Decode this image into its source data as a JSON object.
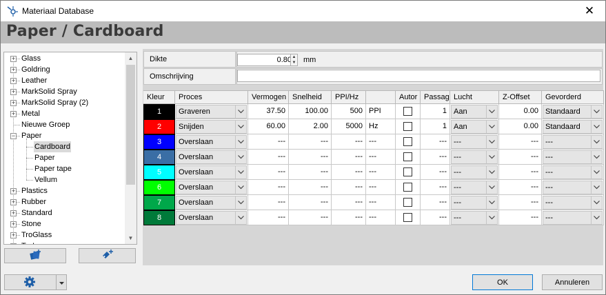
{
  "window": {
    "title": "Materiaal Database",
    "close_label": "✕"
  },
  "page_title": "Paper / Cardboard",
  "tree": {
    "items": [
      {
        "label": "Glass",
        "expander": "+",
        "level": 0
      },
      {
        "label": "Goldring",
        "expander": "+",
        "level": 0
      },
      {
        "label": "Leather",
        "expander": "+",
        "level": 0
      },
      {
        "label": "MarkSolid Spray",
        "expander": "+",
        "level": 0
      },
      {
        "label": "MarkSolid Spray (2)",
        "expander": "+",
        "level": 0
      },
      {
        "label": "Metal",
        "expander": "+",
        "level": 0
      },
      {
        "label": "Nieuwe Groep",
        "expander": "",
        "level": 0
      },
      {
        "label": "Paper",
        "expander": "−",
        "level": 0
      },
      {
        "label": "Cardboard",
        "expander": "",
        "level": 1,
        "selected": true
      },
      {
        "label": "Paper",
        "expander": "",
        "level": 1
      },
      {
        "label": "Paper tape",
        "expander": "",
        "level": 1
      },
      {
        "label": "Vellum",
        "expander": "",
        "level": 1
      },
      {
        "label": "Plastics",
        "expander": "+",
        "level": 0
      },
      {
        "label": "Rubber",
        "expander": "+",
        "level": 0
      },
      {
        "label": "Standard",
        "expander": "+",
        "level": 0
      },
      {
        "label": "Stone",
        "expander": "+",
        "level": 0
      },
      {
        "label": "TroGlass",
        "expander": "+",
        "level": 0
      },
      {
        "label": "TroLase",
        "expander": "+",
        "level": 0
      }
    ]
  },
  "properties": {
    "thickness_label": "Dikte",
    "thickness_value": "0.80",
    "thickness_unit": "mm",
    "description_label": "Omschrijving",
    "description_value": ""
  },
  "grid": {
    "headers": [
      "Kleur",
      "Proces",
      "Vermogen",
      "Snelheid",
      "PPI/Hz",
      "",
      "Autor",
      "Passage",
      "Lucht",
      "Z-Offset",
      "Gevorderd"
    ],
    "rows": [
      {
        "num": "1",
        "color": "#000000",
        "proces": "Graveren",
        "vermogen": "37.50",
        "snelheid": "100.00",
        "ppi": "500",
        "unit": "PPI",
        "passage": "1",
        "lucht": "Aan",
        "zoffset": "0.00",
        "gevorderd": "Standaard"
      },
      {
        "num": "2",
        "color": "#ff0000",
        "proces": "Snijden",
        "vermogen": "60.00",
        "snelheid": "2.00",
        "ppi": "5000",
        "unit": "Hz",
        "passage": "1",
        "lucht": "Aan",
        "zoffset": "0.00",
        "gevorderd": "Standaard"
      },
      {
        "num": "3",
        "color": "#0000ff",
        "proces": "Overslaan",
        "vermogen": "---",
        "snelheid": "---",
        "ppi": "---",
        "unit": "---",
        "passage": "---",
        "lucht": "---",
        "zoffset": "---",
        "gevorderd": "---"
      },
      {
        "num": "4",
        "color": "#3a6ea5",
        "proces": "Overslaan",
        "vermogen": "---",
        "snelheid": "---",
        "ppi": "---",
        "unit": "---",
        "passage": "---",
        "lucht": "---",
        "zoffset": "---",
        "gevorderd": "---"
      },
      {
        "num": "5",
        "color": "#00ffff",
        "proces": "Overslaan",
        "vermogen": "---",
        "snelheid": "---",
        "ppi": "---",
        "unit": "---",
        "passage": "---",
        "lucht": "---",
        "zoffset": "---",
        "gevorderd": "---"
      },
      {
        "num": "6",
        "color": "#00ff00",
        "proces": "Overslaan",
        "vermogen": "---",
        "snelheid": "---",
        "ppi": "---",
        "unit": "---",
        "passage": "---",
        "lucht": "---",
        "zoffset": "---",
        "gevorderd": "---"
      },
      {
        "num": "7",
        "color": "#00a84a",
        "proces": "Overslaan",
        "vermogen": "---",
        "snelheid": "---",
        "ppi": "---",
        "unit": "---",
        "passage": "---",
        "lucht": "---",
        "zoffset": "---",
        "gevorderd": "---"
      },
      {
        "num": "8",
        "color": "#007a3a",
        "proces": "Overslaan",
        "vermogen": "---",
        "snelheid": "---",
        "ppi": "---",
        "unit": "---",
        "passage": "---",
        "lucht": "---",
        "zoffset": "---",
        "gevorderd": "---"
      }
    ]
  },
  "buttons": {
    "ok": "OK",
    "cancel": "Annuleren",
    "add_material_icon": "add-material-icon",
    "add_group_icon": "add-tag-icon",
    "settings_icon": "gear-icon"
  },
  "colors": {
    "header_band": "#bcbcbc",
    "accent": "#0078d7",
    "panel": "#d6d6d6"
  }
}
